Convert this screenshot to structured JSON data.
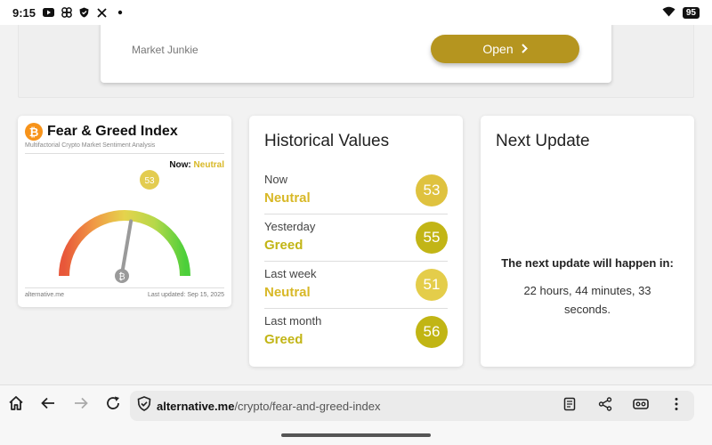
{
  "status": {
    "time": "9:15",
    "battery": "95",
    "icons": [
      "youtube-icon",
      "pinwheel-icon",
      "shield-icon",
      "x-icon",
      "dot-icon",
      "wifi-icon"
    ]
  },
  "ad": {
    "label": "Market Junkie",
    "button": "Open"
  },
  "fear_greed": {
    "title": "Fear & Greed Index",
    "subtitle": "Multifactorial Crypto Market Sentiment Analysis",
    "now_label": "Now:",
    "now_value": "Neutral",
    "value": "53",
    "value_number": 53,
    "footer_left": "alternative.me",
    "footer_right": "Last updated: Sep 15, 2025",
    "logo_glyph": "₿"
  },
  "historical": {
    "title": "Historical Values",
    "rows": [
      {
        "label": "Now",
        "class": "Neutral",
        "value": "53",
        "color": "#dfc23f"
      },
      {
        "label": "Yesterday",
        "class": "Greed",
        "value": "55",
        "color": "#c2b516"
      },
      {
        "label": "Last week",
        "class": "Neutral",
        "value": "51",
        "color": "#e4cd4a"
      },
      {
        "label": "Last month",
        "class": "Greed",
        "value": "56",
        "color": "#c1b514"
      }
    ]
  },
  "next_update": {
    "title": "Next Update",
    "text": "The next update will happen in:",
    "time": "22 hours, 44 minutes, 33 seconds."
  },
  "browser": {
    "url_domain": "alternative.me",
    "url_path": "/crypto/fear-and-greed-index"
  },
  "colors": {
    "accent": "#b5951f",
    "neutral": "#d8b827",
    "greed": "#c2b516"
  }
}
